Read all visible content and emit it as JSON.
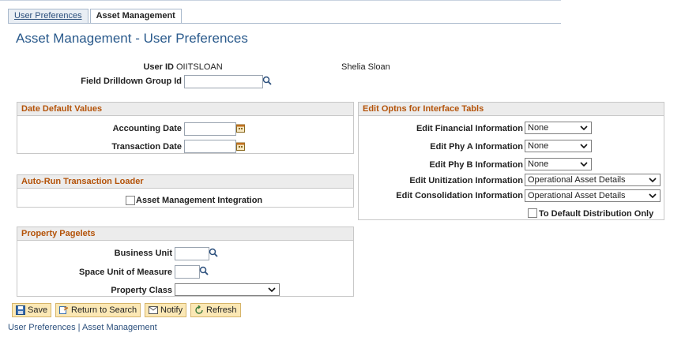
{
  "tabs": [
    {
      "label": "User Preferences",
      "active": false
    },
    {
      "label": "Asset Management",
      "active": true
    }
  ],
  "page_title": "Asset Management - User Preferences",
  "user": {
    "user_id_label": "User ID",
    "user_id_value": "OIITSLOAN",
    "user_name": "Shelia Sloan",
    "drilldown_label": "Field Drilldown Group Id",
    "drilldown_value": ""
  },
  "date_defaults": {
    "header": "Date Default Values",
    "accounting_label": "Accounting Date",
    "accounting_value": "",
    "transaction_label": "Transaction Date",
    "transaction_value": ""
  },
  "auto_run": {
    "header": "Auto-Run Transaction Loader",
    "checkbox_label": "Asset Management Integration",
    "checked": false
  },
  "property": {
    "header": "Property Pagelets",
    "business_unit_label": "Business Unit",
    "business_unit_value": "",
    "space_uom_label": "Space Unit of Measure",
    "space_uom_value": "",
    "property_class_label": "Property Class",
    "property_class_value": ""
  },
  "edit_options": {
    "header": "Edit Optns for Interface Tabls",
    "financial_label": "Edit Financial Information",
    "financial_value": "None",
    "phy_a_label": "Edit Phy A Information",
    "phy_a_value": "None",
    "phy_b_label": "Edit Phy B Information",
    "phy_b_value": "None",
    "unitization_label": "Edit Unitization Information",
    "unitization_value": "Operational Asset Details",
    "consolidation_label": "Edit Consolidation Information",
    "consolidation_value": "Operational Asset Details",
    "default_dist_label": "To Default Distribution Only",
    "default_dist_checked": false
  },
  "toolbar": {
    "save": "Save",
    "return_to_search": "Return to Search",
    "notify": "Notify",
    "refresh": "Refresh"
  },
  "footer": {
    "link1": "User Preferences",
    "separator": " | ",
    "link2": "Asset Management"
  },
  "colors": {
    "title": "#2a5a8c",
    "group_header_text": "#b45309",
    "button_bg": "#fbe8b5"
  }
}
